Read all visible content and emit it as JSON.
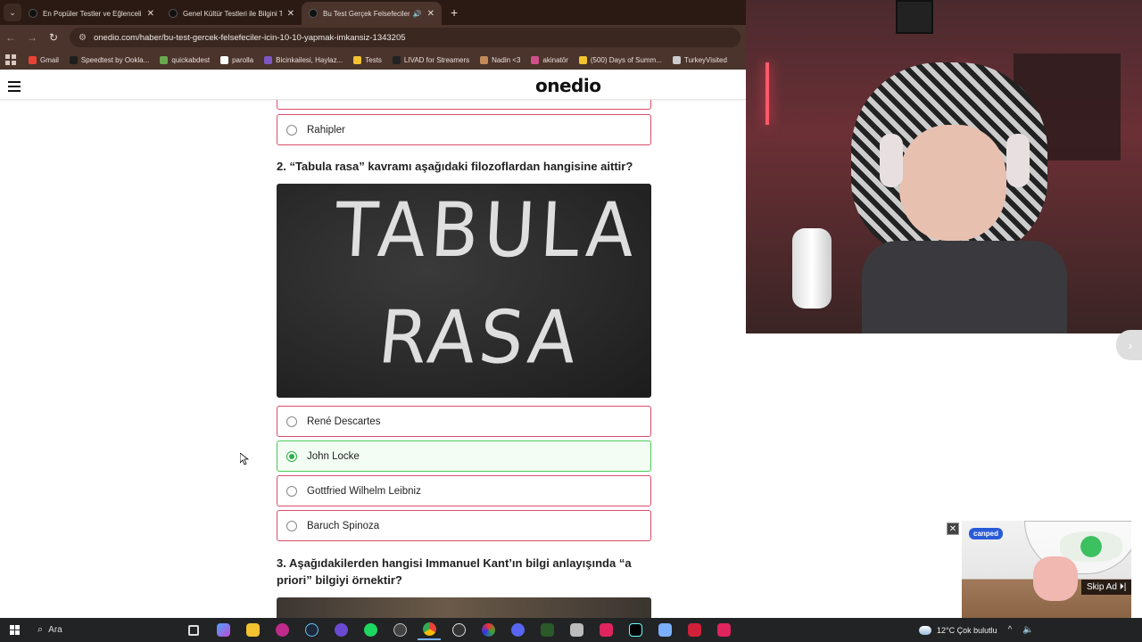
{
  "browser": {
    "tabs": [
      {
        "title": "En Popüler Testler ve Eğlenceli",
        "active": false
      },
      {
        "title": "Genel Kültür Testleri ile Bilgini T",
        "active": false
      },
      {
        "title": "Bu Test Gerçek Felsefeciler",
        "active": true
      }
    ],
    "url": "onedio.com/haber/bu-test-gercek-felsefeciler-icin-10-10-yapmak-imkansiz-1343205",
    "bookmarks": [
      {
        "label": "Gmail",
        "color": "#ea4335"
      },
      {
        "label": "Speedtest by Ookla...",
        "color": "#1e1e1e"
      },
      {
        "label": "quickabdest",
        "color": "#6aa84f"
      },
      {
        "label": "parolla",
        "color": "#ffffff"
      },
      {
        "label": "Bicinkailesi, Haylaz...",
        "color": "#7e57c2"
      },
      {
        "label": "Tests",
        "color": "#f2c230"
      },
      {
        "label": "LIVAD for Streamers",
        "color": "#222222"
      },
      {
        "label": "Nadin <3",
        "color": "#c28a5a"
      },
      {
        "label": "akinatör",
        "color": "#d0508a"
      },
      {
        "label": "(500) Days of Summ...",
        "color": "#f2c230"
      },
      {
        "label": "TurkeyVisited",
        "color": "#cccccc"
      }
    ]
  },
  "site": {
    "logo": "onedio"
  },
  "quiz": {
    "prev_option": "Rahipler",
    "q2": {
      "title": "2. “Tabula rasa” kavramı aşağıdaki filozoflardan hangisine aittir?",
      "image_words": [
        "TABULA",
        "RASA"
      ],
      "options": [
        {
          "label": "René Descartes",
          "selected": false
        },
        {
          "label": "John Locke",
          "selected": true
        },
        {
          "label": "Gottfried Wilhelm Leibniz",
          "selected": false
        },
        {
          "label": "Baruch Spinoza",
          "selected": false
        }
      ]
    },
    "q3": {
      "title": "3. Aşağıdakilerden hangisi Immanuel Kant’ın bilgi anlayışında “a priori” bilgiyi örnektir?"
    }
  },
  "ad": {
    "brand": "canped",
    "close": "✕",
    "skip": "Skip Ad ⏵|"
  },
  "taskbar": {
    "search_label": "Ara",
    "weather": "12°C  Çok bulutlu"
  },
  "colors": {
    "option_border": "#d94d6a",
    "correct_border": "#4bc95a",
    "browser_frame": "#4a342b"
  }
}
